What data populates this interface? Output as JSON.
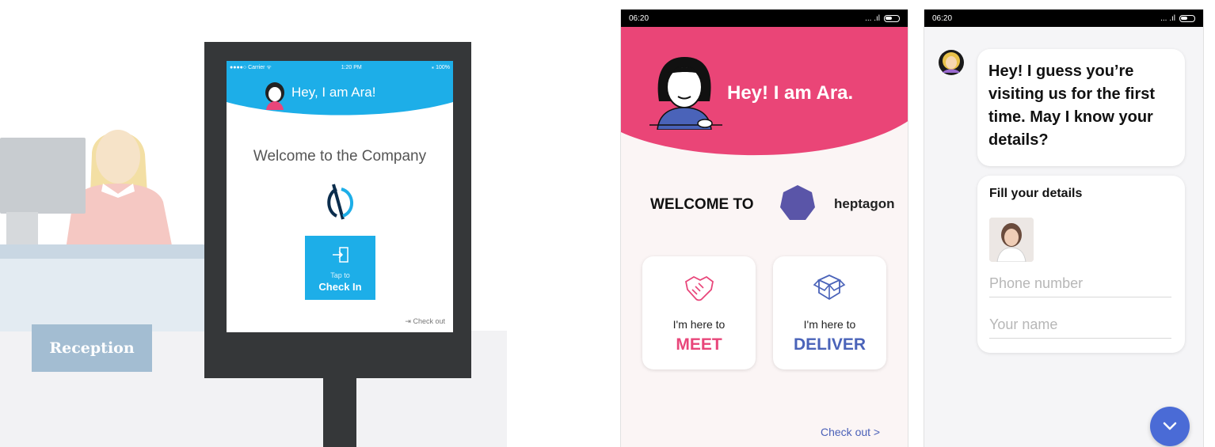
{
  "kiosk": {
    "status_carrier": "●●●●○ Carrier ᯤ",
    "status_time": "1:20 PM",
    "status_battery": "⁎ 100%",
    "title": "Hey, I am Ara!",
    "welcome": "Welcome to the Company",
    "checkin_prefix": "Tap to",
    "checkin_label": "Check In",
    "checkout_label": "Check out",
    "reception_sign": "Reception"
  },
  "phone1": {
    "status_time": "06:20",
    "status_signal": "... .ıl",
    "title": "Hey! I am Ara.",
    "welcome_prefix": "WELCOME TO",
    "brand": "heptagon",
    "options": [
      {
        "pre": "I'm here to",
        "label": "MEET",
        "icon": "handshake-icon",
        "color": "#e8467a"
      },
      {
        "pre": "I'm here to",
        "label": "DELIVER",
        "icon": "box-icon",
        "color": "#4a63b9"
      }
    ],
    "checkout_label": "Check out >",
    "accent": "#ea4577"
  },
  "phone2": {
    "status_time": "06:20",
    "status_signal": "... .ıl",
    "greeting": "Hey! I guess you’re visiting us for the first time. May I know your details?",
    "form_title": "Fill your details",
    "phone_placeholder": "Phone number",
    "name_placeholder": "Your name",
    "fab_icon": "chevron-down-icon",
    "fab_color": "#4a6bd6"
  }
}
